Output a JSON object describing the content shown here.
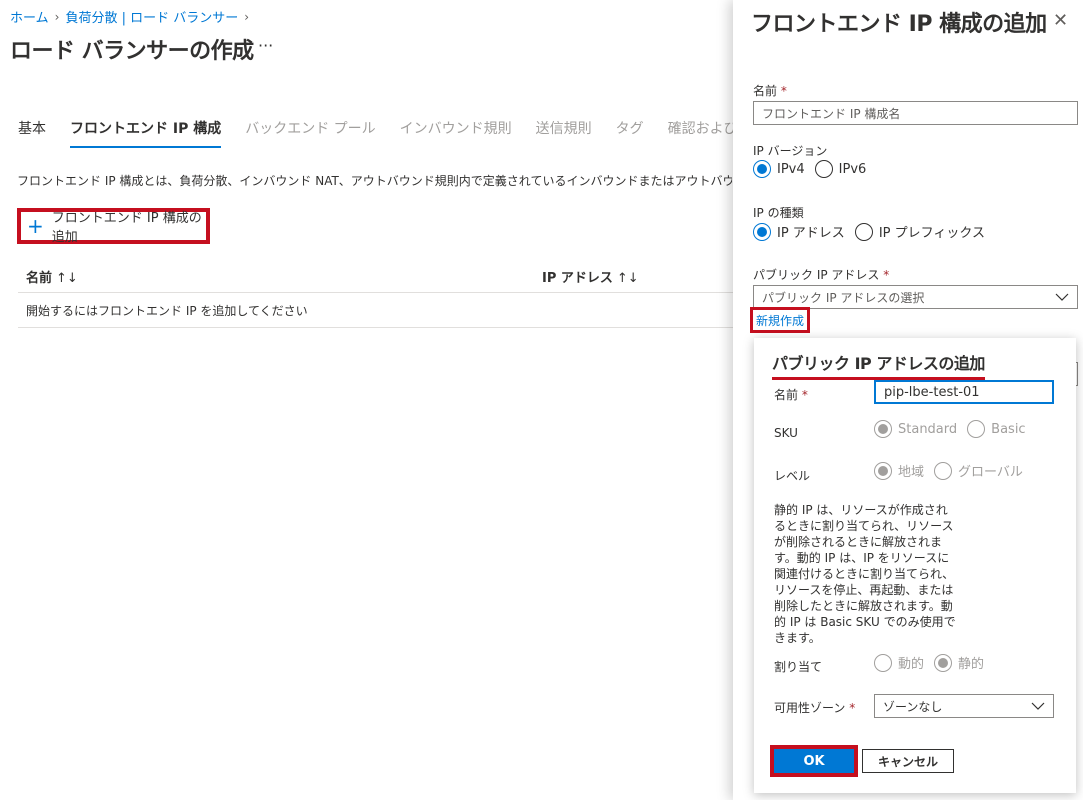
{
  "breadcrumb": {
    "home": "ホーム",
    "item2": "負荷分散 | ロード バランサー"
  },
  "page": {
    "title": "ロード バランサーの作成",
    "more": "···"
  },
  "tabs": [
    "基本",
    "フロントエンド IP 構成",
    "バックエンド プール",
    "インバウンド規則",
    "送信規則",
    "タグ",
    "確認および作成"
  ],
  "description": "フロントエンド IP 構成とは、負荷分散、インバウンド NAT、アウトバウンド規則内で定義されているインバウンドまたはアウトバウンド通信に使用",
  "add_button": {
    "plus": "+",
    "label": "フロントエンド IP 構成の追加"
  },
  "table": {
    "col1": "名前",
    "col2": "IP アドレス",
    "sort": "↑↓",
    "empty": "開始するにはフロントエンド IP を追加してください"
  },
  "panel": {
    "title": "フロントエンド IP 構成の追加",
    "close": "✕",
    "name_label": "名前",
    "required": "*",
    "name_placeholder": "フロントエンド IP 構成名",
    "ip_version_label": "IP バージョン",
    "ipv4": "IPv4",
    "ipv6": "IPv6",
    "ip_type_label": "IP の種類",
    "ip_address": "IP アドレス",
    "ip_prefix": "IP プレフィックス",
    "public_ip_label": "パブリック IP アドレス",
    "public_ip_placeholder": "パブリック IP アドレスの選択",
    "new_link": "新規作成"
  },
  "callout": {
    "title": "パブリック IP アドレスの追加",
    "name_label": "名前",
    "name_value": "pip-lbe-test-01",
    "sku_label": "SKU",
    "sku_standard": "Standard",
    "sku_basic": "Basic",
    "level_label": "レベル",
    "level_region": "地域",
    "level_global": "グローバル",
    "info_text": "静的 IP は、リソースが作成されるときに割り当てられ、リソースが削除されるときに解放されます。動的 IP は、IP をリソースに関連付けるときに割り当てられ、リソースを停止、再起動、または削除したときに解放されます。動的 IP は Basic SKU でのみ使用できます。",
    "assign_label": "割り当て",
    "assign_dynamic": "動的",
    "assign_static": "静的",
    "zone_label": "可用性ゾーン",
    "zone_value": "ゾーンなし",
    "ok": "OK",
    "cancel": "キャンセル"
  },
  "colors": {
    "accent": "#0078d4",
    "highlight": "#c50f1f",
    "required": "#a4262c"
  }
}
